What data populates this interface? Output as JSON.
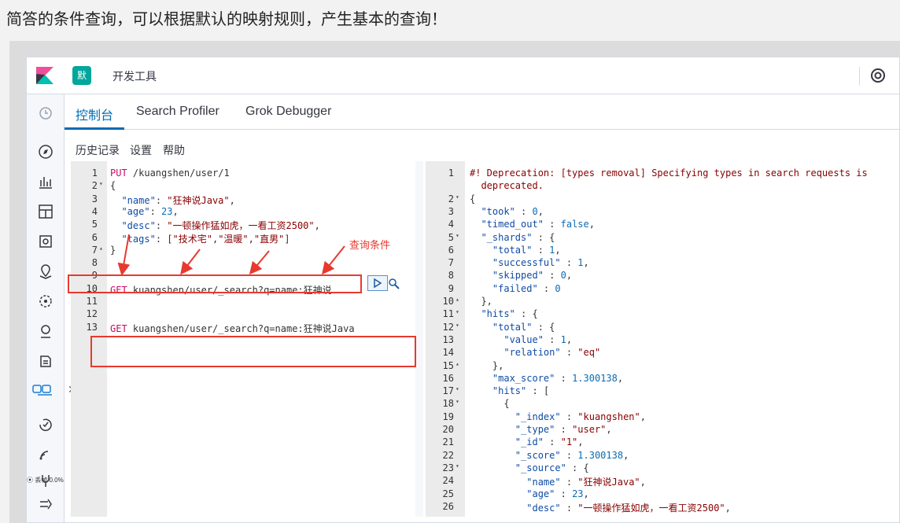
{
  "caption": "简答的条件查询，可以根据默认的映射规则，产生基本的查询！",
  "header": {
    "badge": "默",
    "title": "开发工具"
  },
  "tabs": [
    {
      "label": "控制台"
    },
    {
      "label": "Search Profiler"
    },
    {
      "label": "Grok Debugger"
    }
  ],
  "subnav": {
    "history": "历史记录",
    "settings": "设置",
    "help": "帮助"
  },
  "annotation": "查询条件",
  "status": {
    "text": "⦿ 丢帧 0.0%"
  },
  "request_lines": [
    {
      "n": "1",
      "fold": "",
      "html": "<span class='kw'>PUT</span> /kuangshen/user/1"
    },
    {
      "n": "2",
      "fold": "▾",
      "html": "{"
    },
    {
      "n": "3",
      "fold": "",
      "html": "  <span class='key'>\"name\"</span>: <span class='str'>\"狂神说Java\"</span>,"
    },
    {
      "n": "4",
      "fold": "",
      "html": "  <span class='key'>\"age\"</span>: <span class='num'>23</span>,"
    },
    {
      "n": "5",
      "fold": "",
      "html": "  <span class='key'>\"desc\"</span>: <span class='str'>\"一顿操作猛如虎，一看工资2500\"</span>,"
    },
    {
      "n": "6",
      "fold": "",
      "html": "  <span class='key'>\"tags\"</span>: [<span class='str'>\"技术宅\"</span>,<span class='str'>\"温暖\"</span>,<span class='str'>\"直男\"</span>]"
    },
    {
      "n": "7",
      "fold": "▴",
      "html": "}"
    },
    {
      "n": "8",
      "fold": "",
      "html": ""
    },
    {
      "n": "9",
      "fold": "",
      "html": ""
    },
    {
      "n": "10",
      "fold": "",
      "html": "<span class='kw'>GET</span> kuangshen/user/_search?q=name:狂神说"
    },
    {
      "n": "11",
      "fold": "",
      "html": ""
    },
    {
      "n": "12",
      "fold": "",
      "html": ""
    },
    {
      "n": "13",
      "fold": "",
      "html": "<span class='kw'>GET</span> kuangshen/user/_search?q=name:狂神说Java"
    }
  ],
  "response_lines": [
    {
      "n": "1",
      "fold": "",
      "html": "<span class='str'>#! Deprecation: [types removal] Specifying types in search requests is</span>"
    },
    {
      "n": "",
      "fold": "",
      "html": "<span class='str'>  deprecated.</span>"
    },
    {
      "n": "2",
      "fold": "▾",
      "html": "{"
    },
    {
      "n": "3",
      "fold": "",
      "html": "  <span class='key'>\"took\"</span> : <span class='num'>0</span>,"
    },
    {
      "n": "4",
      "fold": "",
      "html": "  <span class='key'>\"timed_out\"</span> : <span class='num'>false</span>,"
    },
    {
      "n": "5",
      "fold": "▾",
      "html": "  <span class='key'>\"_shards\"</span> : {"
    },
    {
      "n": "6",
      "fold": "",
      "html": "    <span class='key'>\"total\"</span> : <span class='num'>1</span>,"
    },
    {
      "n": "7",
      "fold": "",
      "html": "    <span class='key'>\"successful\"</span> : <span class='num'>1</span>,"
    },
    {
      "n": "8",
      "fold": "",
      "html": "    <span class='key'>\"skipped\"</span> : <span class='num'>0</span>,"
    },
    {
      "n": "9",
      "fold": "",
      "html": "    <span class='key'>\"failed\"</span> : <span class='num'>0</span>"
    },
    {
      "n": "10",
      "fold": "▴",
      "html": "  },"
    },
    {
      "n": "11",
      "fold": "▾",
      "html": "  <span class='key'>\"hits\"</span> : {"
    },
    {
      "n": "12",
      "fold": "▾",
      "html": "    <span class='key'>\"total\"</span> : {"
    },
    {
      "n": "13",
      "fold": "",
      "html": "      <span class='key'>\"value\"</span> : <span class='num'>1</span>,"
    },
    {
      "n": "14",
      "fold": "",
      "html": "      <span class='key'>\"relation\"</span> : <span class='str'>\"eq\"</span>"
    },
    {
      "n": "15",
      "fold": "▴",
      "html": "    },"
    },
    {
      "n": "16",
      "fold": "",
      "html": "    <span class='key'>\"max_score\"</span> : <span class='num'>1.300138</span>,"
    },
    {
      "n": "17",
      "fold": "▾",
      "html": "    <span class='key'>\"hits\"</span> : ["
    },
    {
      "n": "18",
      "fold": "▾",
      "html": "      {"
    },
    {
      "n": "19",
      "fold": "",
      "html": "        <span class='key'>\"_index\"</span> : <span class='str'>\"kuangshen\"</span>,"
    },
    {
      "n": "20",
      "fold": "",
      "html": "        <span class='key'>\"_type\"</span> : <span class='str'>\"user\"</span>,"
    },
    {
      "n": "21",
      "fold": "",
      "html": "        <span class='key'>\"_id\"</span> : <span class='str'>\"1\"</span>,"
    },
    {
      "n": "22",
      "fold": "",
      "html": "        <span class='key'>\"_score\"</span> : <span class='num'>1.300138</span>,"
    },
    {
      "n": "23",
      "fold": "▾",
      "html": "        <span class='key'>\"_source\"</span> : {"
    },
    {
      "n": "24",
      "fold": "",
      "html": "          <span class='key'>\"name\"</span> : <span class='str'>\"狂神说Java\"</span>,"
    },
    {
      "n": "25",
      "fold": "",
      "html": "          <span class='key'>\"age\"</span> : <span class='num'>23</span>,"
    },
    {
      "n": "26",
      "fold": "",
      "html": "          <span class='key'>\"desc\"</span> : <span class='str'>\"一顿操作猛如虎，一看工资2500\"</span>,"
    }
  ]
}
